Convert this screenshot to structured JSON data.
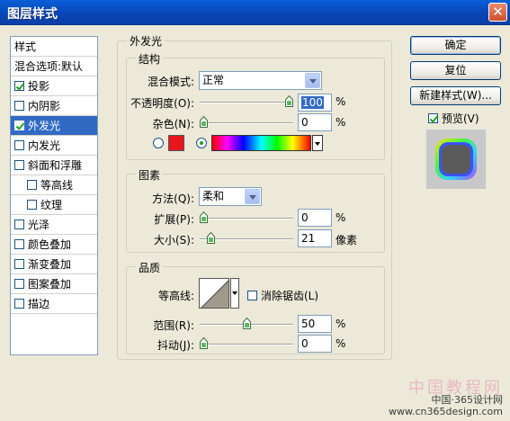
{
  "window": {
    "title": "图层样式",
    "close_glyph": "✕"
  },
  "style_list": {
    "header": "样式",
    "items": [
      {
        "label": "混合选项:默认",
        "checkbox": false,
        "checked": false,
        "indent": false,
        "selected": false
      },
      {
        "label": "投影",
        "checkbox": true,
        "checked": true,
        "indent": false,
        "selected": false
      },
      {
        "label": "内阴影",
        "checkbox": true,
        "checked": false,
        "indent": false,
        "selected": false
      },
      {
        "label": "外发光",
        "checkbox": true,
        "checked": true,
        "indent": false,
        "selected": true
      },
      {
        "label": "内发光",
        "checkbox": true,
        "checked": false,
        "indent": false,
        "selected": false
      },
      {
        "label": "斜面和浮雕",
        "checkbox": true,
        "checked": false,
        "indent": false,
        "selected": false
      },
      {
        "label": "等高线",
        "checkbox": true,
        "checked": false,
        "indent": true,
        "selected": false
      },
      {
        "label": "纹理",
        "checkbox": true,
        "checked": false,
        "indent": true,
        "selected": false
      },
      {
        "label": "光泽",
        "checkbox": true,
        "checked": false,
        "indent": false,
        "selected": false
      },
      {
        "label": "颜色叠加",
        "checkbox": true,
        "checked": false,
        "indent": false,
        "selected": false
      },
      {
        "label": "渐变叠加",
        "checkbox": true,
        "checked": false,
        "indent": false,
        "selected": false
      },
      {
        "label": "图案叠加",
        "checkbox": true,
        "checked": false,
        "indent": false,
        "selected": false
      },
      {
        "label": "描边",
        "checkbox": true,
        "checked": false,
        "indent": false,
        "selected": false
      }
    ]
  },
  "outer_glow": {
    "title": "外发光",
    "structure": {
      "title": "结构",
      "blend_mode_label": "混合模式:",
      "blend_mode_value": "正常",
      "opacity_label": "不透明度(O):",
      "opacity_value": "100",
      "opacity_unit": "%",
      "opacity_level": 1.0,
      "noise_label": "杂色(N):",
      "noise_value": "0",
      "noise_unit": "%",
      "noise_level": 0.0,
      "color_swatch": "#e8161c",
      "gradient_selected": true
    },
    "elements": {
      "title": "图素",
      "method_label": "方法(Q):",
      "method_value": "柔和",
      "spread_label": "扩展(P):",
      "spread_value": "0",
      "spread_unit": "%",
      "spread_level": 0.0,
      "size_label": "大小(S):",
      "size_value": "21",
      "size_unit": "像素",
      "size_level": 0.085
    },
    "quality": {
      "title": "品质",
      "contour_label": "等高线:",
      "antialias_label": "消除锯齿(L)",
      "antialias_checked": false,
      "range_label": "范围(R):",
      "range_value": "50",
      "range_unit": "%",
      "range_level": 0.5,
      "jitter_label": "抖动(J):",
      "jitter_value": "0",
      "jitter_unit": "%",
      "jitter_level": 0.0
    }
  },
  "buttons": {
    "ok": "确定",
    "reset": "复位",
    "new_style": "新建样式(W)...",
    "preview_label": "预览(V)",
    "preview_checked": true
  },
  "watermark": {
    "title": "中国教程网",
    "line1": "中国·365设计网",
    "line2": "www.cn365design.com"
  }
}
